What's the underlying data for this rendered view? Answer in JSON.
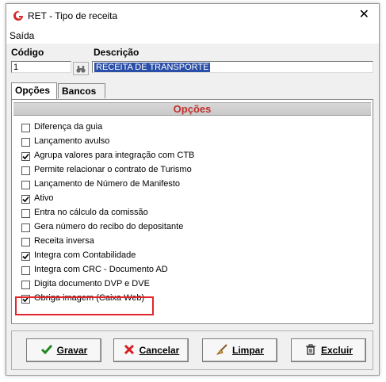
{
  "window": {
    "title": "RET - Tipo de receita",
    "close_glyph": "✕"
  },
  "menu": {
    "items": [
      "Saída"
    ]
  },
  "form": {
    "codigo_label": "Código",
    "codigo_value": "1",
    "descricao_label": "Descrição",
    "descricao_value": "RECEITA DE TRANSPORTE"
  },
  "tabs": [
    {
      "label": "Opções",
      "active": true
    },
    {
      "label": "Bancos",
      "active": false
    }
  ],
  "options_panel": {
    "header": "Opções",
    "items": [
      {
        "label": "Diferença da guia",
        "checked": false
      },
      {
        "label": "Lançamento avulso",
        "checked": false
      },
      {
        "label": "Agrupa valores para integração com CTB",
        "checked": true
      },
      {
        "label": "Permite relacionar o contrato de Turismo",
        "checked": false
      },
      {
        "label": "Lançamento de Número de Manifesto",
        "checked": false
      },
      {
        "label": "Ativo",
        "checked": true
      },
      {
        "label": "Entra no cálculo da comissão",
        "checked": false
      },
      {
        "label": "Gera número do recibo do depositante",
        "checked": false
      },
      {
        "label": "Receita inversa",
        "checked": false
      },
      {
        "label": "Integra com Contabilidade",
        "checked": true
      },
      {
        "label": "Integra com CRC - Documento AD",
        "checked": false
      },
      {
        "label": "Digita documento DVP e DVE",
        "checked": false
      },
      {
        "label": "Obriga imagem (Caixa Web)",
        "checked": true
      }
    ]
  },
  "buttons": {
    "gravar": {
      "label": "Gravar",
      "icon": "check-icon"
    },
    "cancelar": {
      "label": "Cancelar",
      "icon": "x-icon"
    },
    "limpar": {
      "label": "Limpar",
      "icon": "broom-icon"
    },
    "excluir": {
      "label": "Excluir",
      "icon": "trash-icon"
    }
  },
  "colors": {
    "accent_header_text": "#c0302a",
    "highlight_border": "#e0262a",
    "selection_bg": "#2a4fa8",
    "check_green": "#1f8a1f",
    "cancel_red": "#d42020"
  }
}
